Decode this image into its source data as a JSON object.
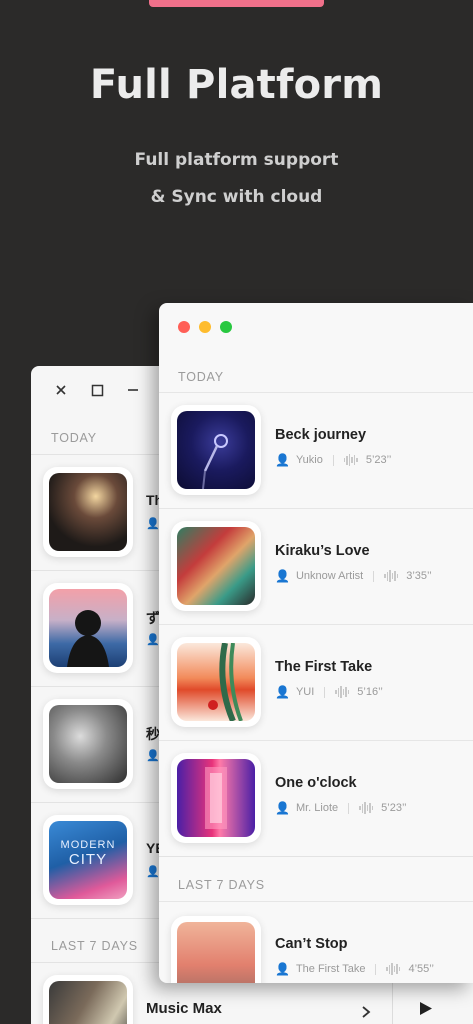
{
  "hero": {
    "title": "Full Platform",
    "subtitle_line1": "Full platform support",
    "subtitle_line2": "&  Sync with cloud"
  },
  "colors": {
    "background": "#2b2a29",
    "accent_pill": "#f0708a",
    "mac_close": "#ff5f57",
    "mac_minimize": "#febc2e",
    "mac_zoom": "#28c840"
  },
  "back_window": {
    "controls": [
      "close-icon",
      "maximize-icon",
      "minimize-icon"
    ],
    "section_today": "TODAY",
    "section_last7": "LAST 7 DAYS",
    "items": [
      {
        "title_visible": "Th",
        "artwork": "concert-singer"
      },
      {
        "title_visible": "ず",
        "artwork": "girl-sunset"
      },
      {
        "title_visible": "秒",
        "artwork": "guitarist-bw"
      },
      {
        "title_visible": "YE",
        "artwork": "modern-city"
      }
    ],
    "artwork_text": {
      "modern_city_line1": "MODERN",
      "modern_city_line2": "CITY"
    },
    "player": {
      "title": "Music Max",
      "next_icon": "chevron-right-icon",
      "play_icon": "play-icon"
    }
  },
  "front_window": {
    "section_today": "TODAY",
    "section_last7": "LAST 7 DAYS",
    "today_items": [
      {
        "title": "Beck journey",
        "artist": "Yukio",
        "duration": "5’23’’"
      },
      {
        "title": "Kiraku’s Love",
        "artist": "Unknow Artist",
        "duration": "3’35’’"
      },
      {
        "title": "The First Take",
        "artist": "YUI",
        "duration": "5’16’’"
      },
      {
        "title": "One o'clock",
        "artist": "Mr. Liote",
        "duration": "5’23’’"
      }
    ],
    "last7_items": [
      {
        "title": "Can’t Stop",
        "artist": "The First Take",
        "duration": "4’55’’"
      }
    ]
  }
}
